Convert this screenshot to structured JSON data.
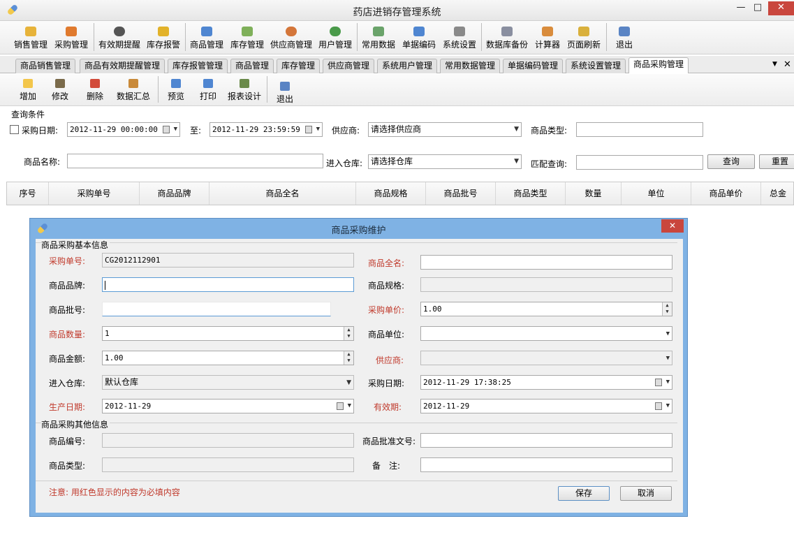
{
  "window": {
    "title": "药店进销存管理系统",
    "minimize": "—",
    "maximize": "□",
    "close": "✕"
  },
  "toolbar": {
    "items": [
      {
        "label": "销售管理",
        "icon": "shopping-basket-icon",
        "color": "#e7b33a"
      },
      {
        "label": "采购管理",
        "icon": "purchase-basket-icon",
        "color": "#e07a2e"
      },
      {
        "label": "有效期提醒",
        "icon": "clock-icon",
        "color": "#555555"
      },
      {
        "label": "库存报警",
        "icon": "warning-icon",
        "color": "#e2b22a"
      },
      {
        "label": "商品管理",
        "icon": "capsule-icon",
        "color": "#4f86d1"
      },
      {
        "label": "库存管理",
        "icon": "stock-icon",
        "color": "#7fb05a"
      },
      {
        "label": "供应商管理",
        "icon": "supplier-person-icon",
        "color": "#d4763a"
      },
      {
        "label": "用户管理",
        "icon": "user-person-icon",
        "color": "#4a9a4a"
      },
      {
        "label": "常用数据",
        "icon": "calendar-icon",
        "color": "#6aa36a"
      },
      {
        "label": "单据编码",
        "icon": "barcode-document-icon",
        "color": "#4f86d1"
      },
      {
        "label": "系统设置",
        "icon": "tools-icon",
        "color": "#8a8a8a"
      },
      {
        "label": "数据库备份",
        "icon": "database-icon",
        "color": "#8a8fa0"
      },
      {
        "label": "计算器",
        "icon": "calculator-icon",
        "color": "#d98c3c"
      },
      {
        "label": "页面刷新",
        "icon": "refresh-icon",
        "color": "#d9b03c"
      },
      {
        "label": "退出",
        "icon": "exit-icon",
        "color": "#5a84c4"
      }
    ]
  },
  "tabs": {
    "items": [
      {
        "label": "商品销售管理"
      },
      {
        "label": "商品有效期提醒管理"
      },
      {
        "label": "库存报管管理"
      },
      {
        "label": "商品管理"
      },
      {
        "label": "库存管理"
      },
      {
        "label": "供应商管理"
      },
      {
        "label": "系统用户管理"
      },
      {
        "label": "常用数据管理"
      },
      {
        "label": "单据编码管理"
      },
      {
        "label": "系统设置管理"
      },
      {
        "label": "商品采购管理"
      }
    ],
    "dropdown": "▼",
    "close": "✕"
  },
  "subtoolbar": {
    "items": [
      {
        "label": "增加",
        "icon": "add-document-icon",
        "color": "#f3c64b"
      },
      {
        "label": "修改",
        "icon": "edit-pencil-icon",
        "color": "#7a6a4a"
      },
      {
        "label": "删除",
        "icon": "delete-x-icon",
        "color": "#d24b3a"
      },
      {
        "label": "数据汇总",
        "icon": "summary-table-icon",
        "color": "#c98a3a"
      },
      {
        "label": "预览",
        "icon": "preview-icon",
        "color": "#4f86d1"
      },
      {
        "label": "打印",
        "icon": "printer-icon",
        "color": "#4f86d1"
      },
      {
        "label": "报表设计",
        "icon": "report-design-icon",
        "color": "#6a8a4a"
      },
      {
        "label": "退出",
        "icon": "exit-icon",
        "color": "#5a84c4"
      }
    ]
  },
  "query": {
    "group_title": "查询条件",
    "purchase_date_label": "采购日期:",
    "date_from": "2012-11-29 00:00:00",
    "to_label": "至:",
    "date_to": "2012-11-29 23:59:59",
    "supplier_label": "供应商:",
    "supplier_value": "请选择供应商",
    "product_type_label": "商品类型:",
    "product_type_value": "",
    "product_name_label": "商品名称:",
    "product_name_value": "",
    "warehouse_label": "进入仓库:",
    "warehouse_value": "请选择仓库",
    "match_label": "匹配查询:",
    "match_value": "",
    "search_button": "查询",
    "reset_button": "重置"
  },
  "grid": {
    "columns": [
      "序号",
      "采购单号",
      "商品品牌",
      "商品全名",
      "商品规格",
      "商品批号",
      "商品类型",
      "数量",
      "单位",
      "商品单价",
      "总金"
    ]
  },
  "dialog": {
    "title": "商品采购维护",
    "close": "✕",
    "basic_group": "商品采购基本信息",
    "fields": {
      "order_no_label": "采购单号:",
      "order_no": "CG2012112901",
      "full_name_label": "商品全名:",
      "full_name": "",
      "brand_label": "商品品牌:",
      "brand": "",
      "spec_label": "商品规格:",
      "spec": "",
      "batch_label": "商品批号:",
      "batch": "",
      "unit_price_label": "采购单价:",
      "unit_price": "1.00",
      "qty_label": "商品数量:",
      "qty": "1",
      "unit_label": "商品单位:",
      "unit": "",
      "amount_label": "商品金额:",
      "amount": "1.00",
      "supplier_label": "供应商:",
      "supplier": "",
      "warehouse_label": "进入仓库:",
      "warehouse": "默认仓库",
      "purchase_date_label": "采购日期:",
      "purchase_date": "2012-11-29 17:38:25",
      "produce_date_label": "生产日期:",
      "produce_date": "2012-11-29",
      "expiry_label": "有效期:",
      "expiry": "2012-11-29"
    },
    "other_group": "商品采购其他信息",
    "other": {
      "code_label": "商品编号:",
      "code": "",
      "approval_label": "商品批准文号:",
      "approval": "",
      "type_label": "商品类型:",
      "type": "",
      "remark_label": "备　注:",
      "remark": ""
    },
    "note": "注意: 用红色显示的内容为必填内容",
    "save_button": "保存",
    "cancel_button": "取消"
  }
}
